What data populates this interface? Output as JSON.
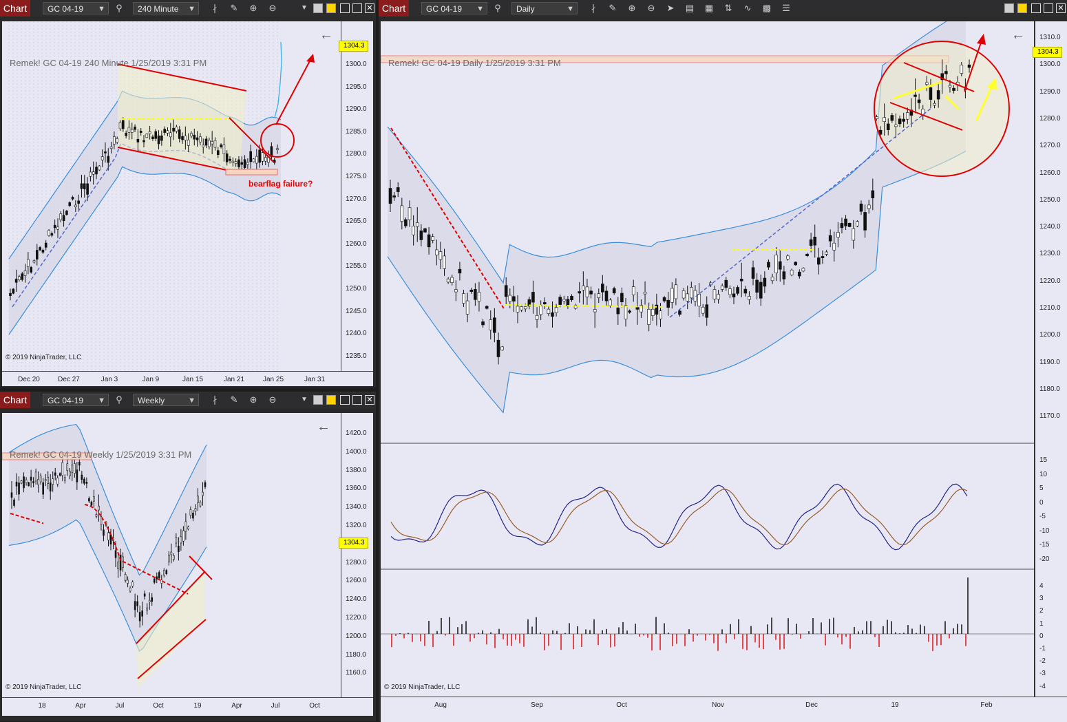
{
  "panels": {
    "p240": {
      "tab": "Chart",
      "instrument": "GC 04-19",
      "interval": "240 Minute",
      "header": "Remek!  GC 04-19  240 Minute  1/25/2019 3:31 PM",
      "copyright": "© 2019 NinjaTrader, LLC",
      "annotation": "bearflag failure?",
      "price_tag": "1304.3",
      "y_ticks": [
        "1300.0",
        "1295.0",
        "1290.0",
        "1285.0",
        "1280.0",
        "1275.0",
        "1270.0",
        "1265.0",
        "1260.0",
        "1255.0",
        "1250.0",
        "1245.0",
        "1240.0",
        "1235.0"
      ],
      "x_ticks": [
        "Dec 20",
        "Dec 27",
        "Jan 3",
        "Jan 9",
        "Jan 15",
        "Jan 21",
        "Jan 25",
        "Jan 31"
      ]
    },
    "pWeekly": {
      "tab": "Chart",
      "instrument": "GC 04-19",
      "interval": "Weekly",
      "header": "Remek!  GC 04-19  Weekly  1/25/2019 3:31 PM",
      "copyright": "© 2019 NinjaTrader, LLC",
      "price_tag": "1304.3",
      "y_ticks": [
        "1420.0",
        "1400.0",
        "1380.0",
        "1360.0",
        "1340.0",
        "1320.0",
        "1300.0",
        "1280.0",
        "1260.0",
        "1240.0",
        "1220.0",
        "1200.0",
        "1180.0",
        "1160.0"
      ],
      "x_ticks": [
        "18",
        "Apr",
        "Jul",
        "Oct",
        "19",
        "Apr",
        "Jul",
        "Oct"
      ]
    },
    "pDaily": {
      "tab": "Chart",
      "instrument": "GC 04-19",
      "interval": "Daily",
      "header": "Remek!  GC 04-19  Daily  1/25/2019 3:31 PM",
      "copyright": "© 2019 NinjaTrader, LLC",
      "price_tag": "1304.3",
      "y_ticks": [
        "1310.0",
        "1300.0",
        "1290.0",
        "1280.0",
        "1270.0",
        "1260.0",
        "1250.0",
        "1240.0",
        "1230.0",
        "1220.0",
        "1210.0",
        "1200.0",
        "1190.0",
        "1180.0",
        "1170.0"
      ],
      "osc_ticks": [
        "15",
        "10",
        "5",
        "0",
        "-5",
        "-10",
        "-15",
        "-20"
      ],
      "vol_ticks": [
        "4",
        "3",
        "2",
        "1",
        "0",
        "-1",
        "-2",
        "-3",
        "-4"
      ],
      "x_ticks": [
        "Aug",
        "Sep",
        "Oct",
        "Nov",
        "Dec",
        "19",
        "Feb"
      ]
    }
  },
  "colors": {
    "tab_red": "#8a1c1c",
    "plot_bg": "#e8e8f5",
    "band": "#3a8fdb",
    "trend_red": "#e00000",
    "midline_yellow": "#ffff00",
    "ma_blue": "#5566cc",
    "highlight_yellow": "#ffff30"
  },
  "icons": [
    "search-icon",
    "bars-icon",
    "pencil-icon",
    "zoom-in-icon",
    "zoom-out-icon",
    "dropdown-icon",
    "minimize-icon",
    "maximize-icon",
    "close-icon",
    "back-arrow-icon"
  ]
}
